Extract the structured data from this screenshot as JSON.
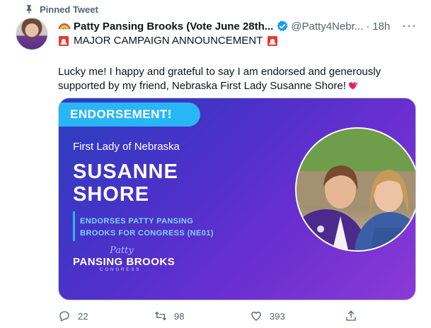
{
  "pinned": {
    "label": "Pinned Tweet"
  },
  "tweet": {
    "display_name": "Patty Pansing Brooks (Vote June 28th...",
    "handle": "@Patty4Nebr...",
    "separator": "·",
    "time": "18h",
    "more": "···",
    "announcement": "MAJOR CAMPAIGN ANNOUNCEMENT",
    "body": "Lucky me! I happy and grateful to say I am endorsed and generously supported by my friend, Nebraska First Lady Susanne Shore!"
  },
  "card": {
    "tag": "ENDORSEMENT!",
    "first_lady": "First Lady of Nebraska",
    "name_line1": "SUSANNE",
    "name_line2": "SHORE",
    "endorse_line1": "ENDORSES PATTY PANSING",
    "endorse_line2": "BROOKS FOR CONGRESS (NE01)",
    "logo_script": "Patty",
    "logo_main": "PANSING BROOKS",
    "logo_sub": "CONGRESS"
  },
  "actions": {
    "reply_count": "22",
    "retweet_count": "98",
    "like_count": "393"
  },
  "icons": {
    "pin": "pin-icon",
    "verified": "verified-badge-icon",
    "rainbow": "rainbow-emoji-icon",
    "siren": "siren-emoji-icon",
    "heart": "two-hearts-emoji-icon",
    "reply": "reply-icon",
    "retweet": "retweet-icon",
    "like": "like-icon",
    "share": "share-icon"
  },
  "colors": {
    "verified_blue": "#1d9bf0",
    "card_accent": "#29b6f6",
    "muted_text": "#536471"
  }
}
